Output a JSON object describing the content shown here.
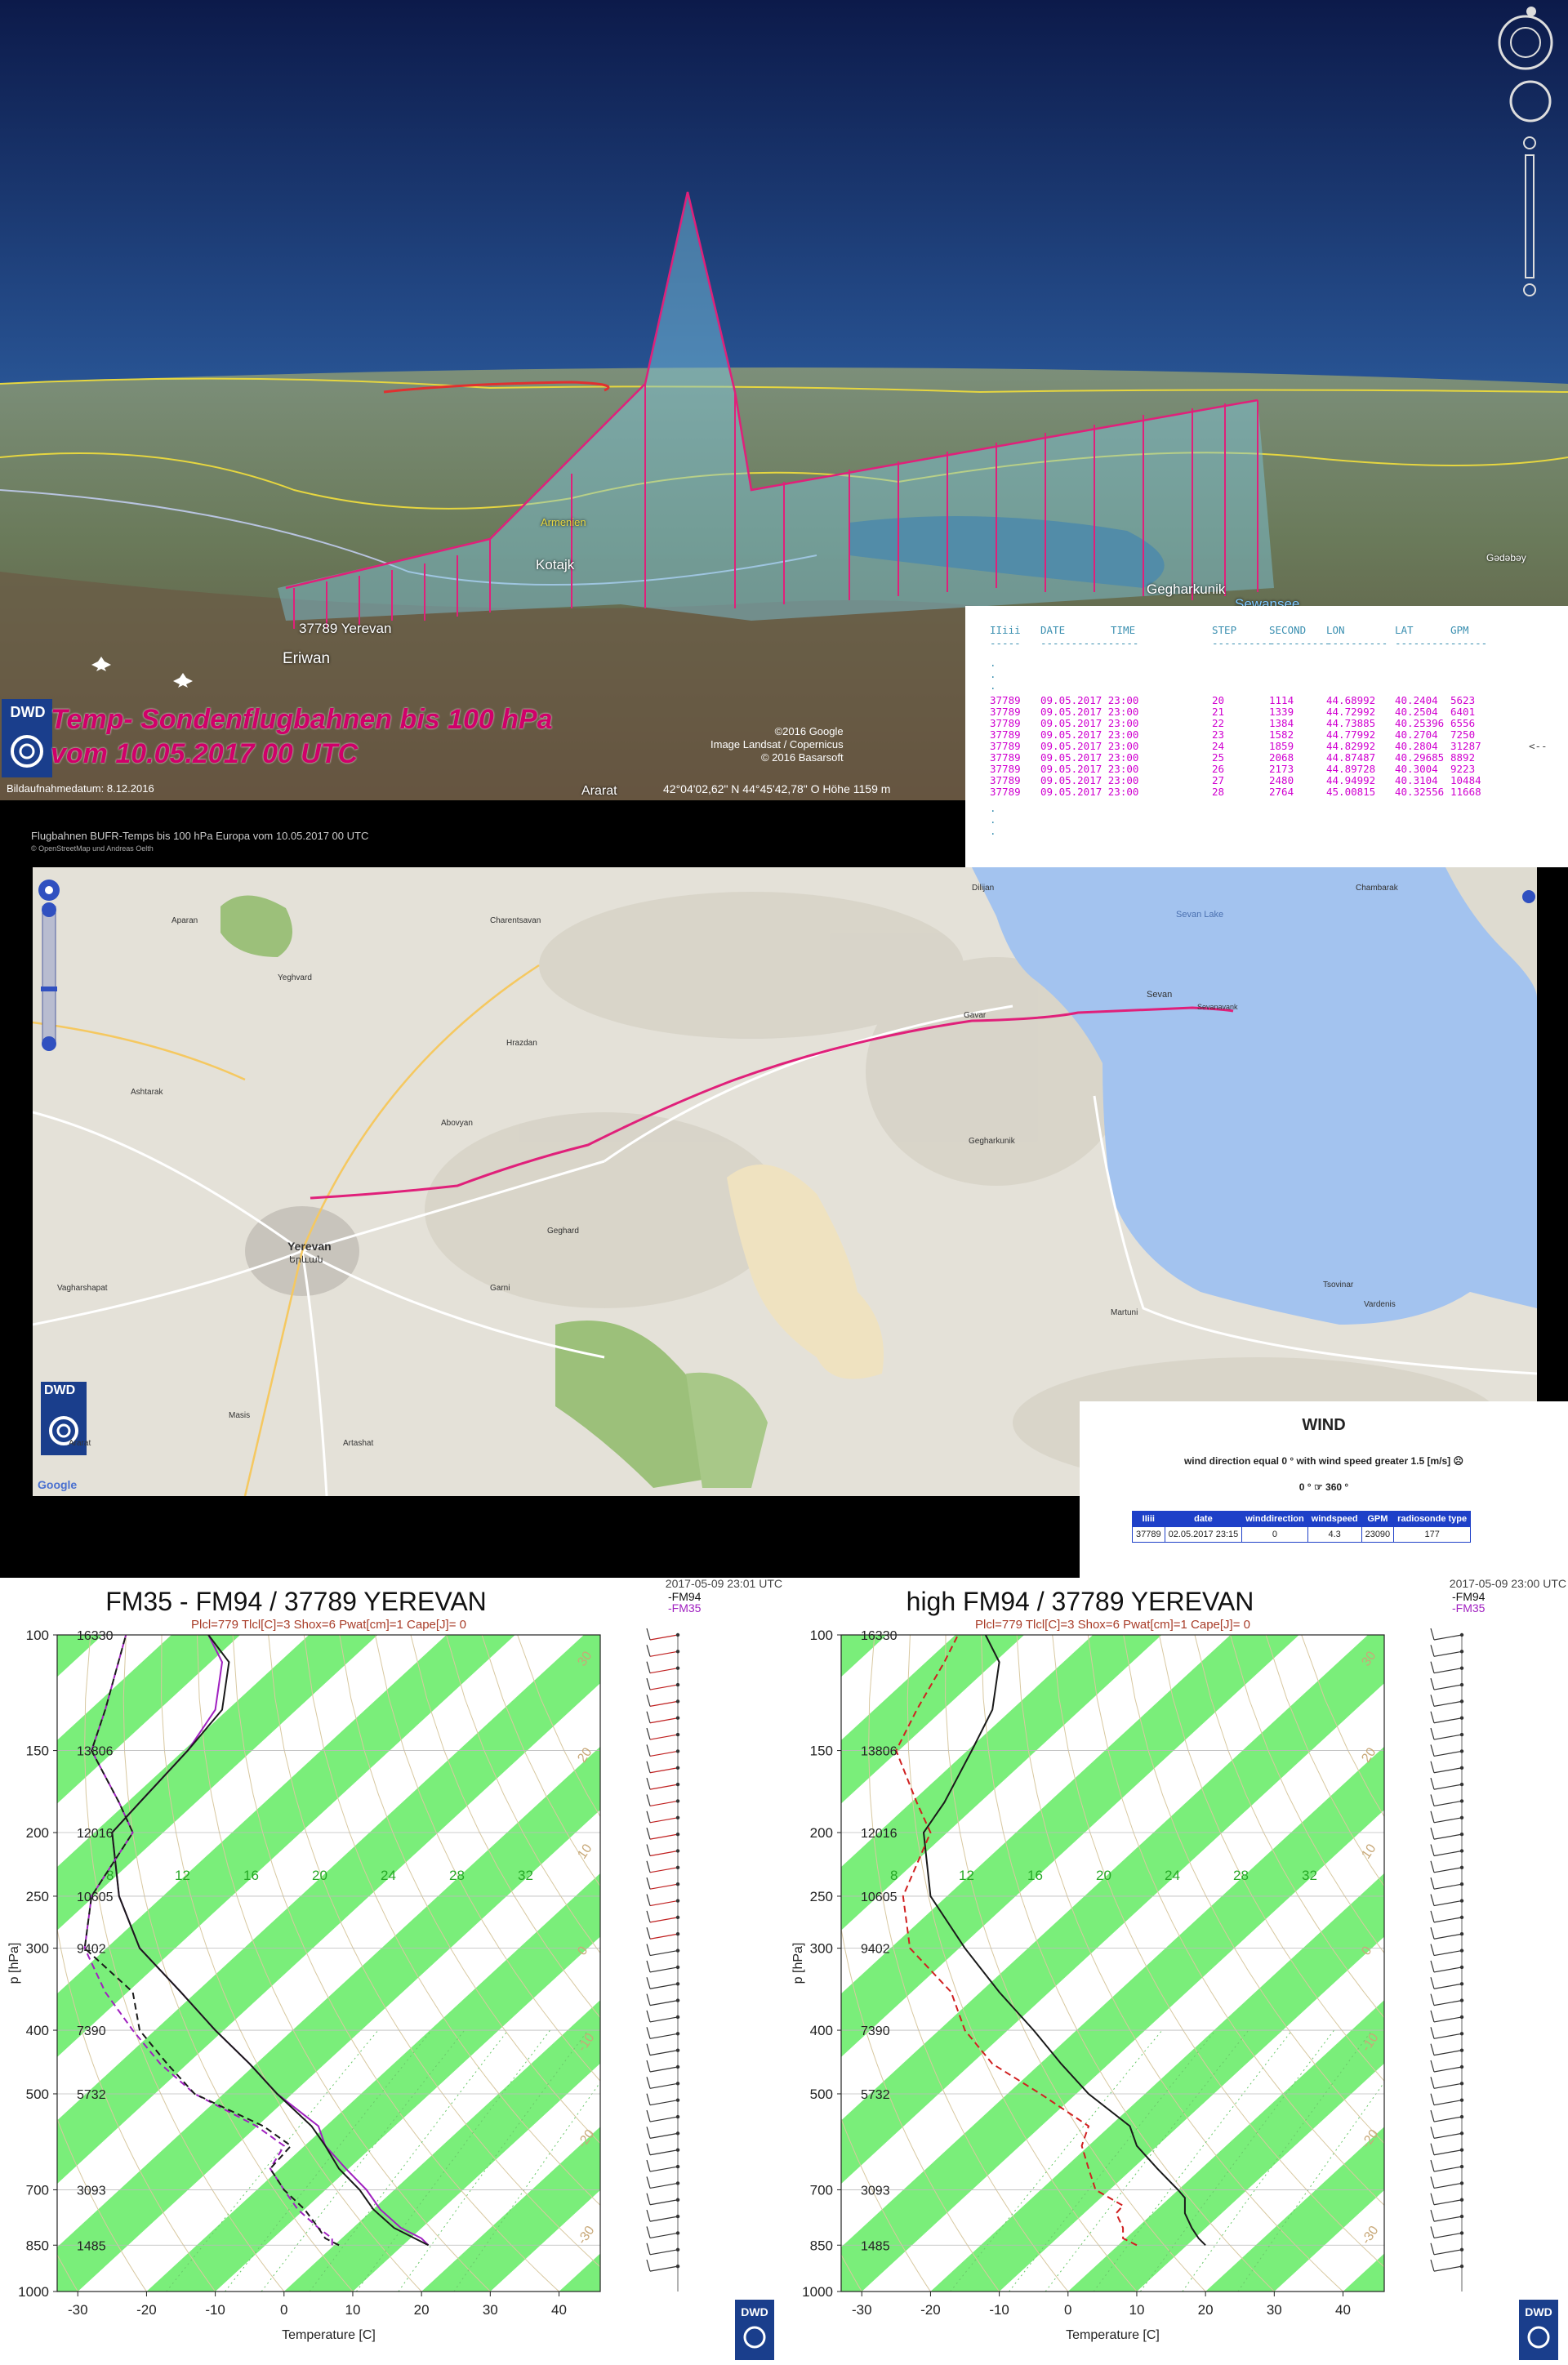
{
  "top_panel": {
    "title_line1": "Temp- Sondenflugbahnen bis 100 hPa",
    "title_line2": "vom 10.05.2017 00 UTC",
    "logo": "DWD",
    "image_date": "Bildaufnahmedatum: 8.12.2016",
    "coords": "42°04'02,62\" N   44°45'42,78\" O Höhe 1159 m",
    "credit1": "©2016 Google",
    "credit2": "Image Landsat / Copernicus",
    "credit3": "© 2016 Basarsoft",
    "places": {
      "station": "37789 Yerevan",
      "eriwan": "Eriwan",
      "kotajk": "Kotajk",
      "armenien": "Armenien",
      "gegharkunik": "Gegharkunik",
      "sevan": "Sewansee",
      "gadabay": "Gədəbəy",
      "ararat": "Ararat"
    }
  },
  "data_table": {
    "header": [
      "IIiii",
      "DATE",
      "TIME",
      "STEP",
      "SECOND",
      "LON",
      "LAT",
      "GPM"
    ],
    "dashes": [
      "-----",
      "----------------",
      "",
      "----------",
      "----------",
      "----------",
      "----------",
      "------"
    ],
    "rows": [
      [
        "37789",
        "09.05.2017 23:00",
        "20",
        "1114",
        "44.68992",
        "40.2404",
        "5623"
      ],
      [
        "37789",
        "09.05.2017 23:00",
        "21",
        "1339",
        "44.72992",
        "40.2504",
        "6401"
      ],
      [
        "37789",
        "09.05.2017 23:00",
        "22",
        "1384",
        "44.73885",
        "40.25396",
        "6556"
      ],
      [
        "37789",
        "09.05.2017 23:00",
        "23",
        "1582",
        "44.77992",
        "40.2704",
        "7250"
      ],
      [
        "37789",
        "09.05.2017 23:00",
        "24",
        "1859",
        "44.82992",
        "40.2804",
        "31287"
      ],
      [
        "37789",
        "09.05.2017 23:00",
        "25",
        "2068",
        "44.87487",
        "40.29685",
        "8892"
      ],
      [
        "37789",
        "09.05.2017 23:00",
        "26",
        "2173",
        "44.89728",
        "40.3004",
        "9223"
      ],
      [
        "37789",
        "09.05.2017 23:00",
        "27",
        "2480",
        "44.94992",
        "40.3104",
        "10484"
      ],
      [
        "37789",
        "09.05.2017 23:00",
        "28",
        "2764",
        "45.00815",
        "40.32556",
        "11668"
      ]
    ],
    "marker": "<--"
  },
  "map": {
    "caption": "Flugbahnen BUFR-Temps bis 100 hPa     Europa vom 10.05.2017 00 UTC",
    "caption_small": "© OpenStreetMap und Andreas Oelth",
    "google": "Google",
    "logo": "DWD",
    "labels": {
      "yerevan": "Yerevan",
      "yerevan_arm": "Երևան",
      "sevan_lake": "Sevan Lake",
      "sevan": "Sevan",
      "gavar": "Gavar",
      "hrazdan": "Hrazdan",
      "abovyan": "Abovyan",
      "ashtarak": "Ashtarak",
      "vagharshapat": "Vagharshapat",
      "masis": "Masis",
      "artashat": "Artashat",
      "martuni": "Martuni",
      "vardenis": "Vardenis",
      "garni": "Garni",
      "yeghvard": "Yeghvard",
      "charentsavan": "Charentsavan",
      "chambarak": "Chambarak",
      "tsovinar": "Tsovinar",
      "gegharkunik": "Gegharkunik",
      "dilijan": "Dilijan",
      "ararat": "Ararat",
      "aparan": "Aparan",
      "geghard": "Geghard",
      "sevanavank": "Sevanavank"
    }
  },
  "wind": {
    "title": "WIND",
    "desc": "wind direction equal 0 ° with wind speed greater 1.5 [m/s] ☹",
    "range": "0 ° ☞ 360 °",
    "columns": [
      "IIiii",
      "date",
      "winddirection",
      "windspeed",
      "GPM",
      "radiosonde type"
    ],
    "row": [
      "37789",
      "02.05.2017 23:15",
      "0",
      "4.3",
      "23090",
      "177"
    ]
  },
  "colors": {
    "trajectory": "#e0207a",
    "dry_bands": "#7aee7a",
    "fm94_series": "#1a1a1a",
    "fm35_series": "#a020c0",
    "high_dew": "#d02020"
  },
  "chart_data": [
    {
      "type": "line",
      "title": "FM35 - FM94 / 37789 YEREVAN",
      "subtitle": "Plcl=779 Tlcl[C]=3 Shox=6 Pwat[cm]=1 Cape[J]= 0",
      "timestamp": "2017-05-09 23:01 UTC",
      "legend": [
        "-FM94",
        "-FM35"
      ],
      "xlabel": "Temperature [C]",
      "ylabel": "p [hPa]",
      "xlim": [
        -33,
        46
      ],
      "ylim": [
        1000,
        100
      ],
      "log_pressure_axis": true,
      "x_ticks": [
        -30,
        -20,
        -10,
        0,
        10,
        20,
        30,
        40
      ],
      "y_ticks": [
        100,
        150,
        200,
        250,
        300,
        400,
        500,
        700,
        850,
        1000
      ],
      "heights": [
        "16330",
        "13806",
        "12016",
        "10605",
        "9402",
        "7390",
        "5732",
        "3093",
        "1485",
        ""
      ],
      "mixing_ratio_labels": [
        "8",
        "12",
        "16",
        "20",
        "24",
        "28",
        "32"
      ],
      "skew_labels": [
        "-30",
        "-20",
        "-10",
        "0",
        "10",
        "20",
        "30"
      ],
      "series": [
        {
          "name": "-FM35",
          "kind": "temperature",
          "p": [
            850,
            830,
            800,
            750,
            700,
            650,
            600,
            560,
            500,
            450,
            400,
            350,
            300,
            250,
            200,
            180,
            150,
            130,
            110,
            100
          ],
          "t": [
            21,
            20,
            17,
            14,
            12,
            9,
            6,
            5,
            -1,
            -5,
            -10,
            -15,
            -21,
            -24,
            -25,
            -21,
            -14,
            -10,
            -9,
            -11
          ]
        },
        {
          "name": "-FM94",
          "kind": "temperature",
          "p": [
            850,
            830,
            800,
            750,
            700,
            650,
            600,
            560,
            500,
            450,
            400,
            350,
            300,
            250,
            200,
            180,
            150,
            130,
            110,
            100
          ],
          "t": [
            21,
            19,
            16,
            13,
            11,
            8,
            6,
            4,
            -1,
            -5,
            -10,
            -15,
            -21,
            -24,
            -25,
            -21,
            -14,
            -9,
            -8,
            -11
          ]
        },
        {
          "name": "-FM35",
          "kind": "dewpoint",
          "p": [
            850,
            830,
            800,
            750,
            700,
            650,
            600,
            560,
            500,
            450,
            400,
            350,
            300,
            250,
            200,
            180,
            150,
            130,
            100
          ],
          "t": [
            7,
            7,
            5,
            2,
            0,
            -2,
            0,
            -4,
            -13,
            -18,
            -22,
            -26,
            -29,
            -28,
            -22,
            -24,
            -28,
            -26,
            -23
          ]
        },
        {
          "name": "-FM94",
          "kind": "dewpoint",
          "p": [
            850,
            830,
            800,
            750,
            700,
            650,
            600,
            560,
            500,
            450,
            400,
            350,
            300,
            250,
            200,
            180,
            150,
            130,
            100
          ],
          "t": [
            8,
            6,
            5,
            3,
            0,
            -2,
            1,
            -3,
            -13,
            -17,
            -21,
            -22,
            -29,
            -28,
            -22,
            -24,
            -28,
            -26,
            -23
          ]
        }
      ]
    },
    {
      "type": "line",
      "title": "high FM94 / 37789 YEREVAN",
      "subtitle": "Plcl=779 Tlcl[C]=3 Shox=6 Pwat[cm]=1 Cape[J]= 0",
      "timestamp": "2017-05-09 23:00 UTC",
      "legend": [
        "-FM94",
        "-FM35"
      ],
      "xlabel": "Temperature [C]",
      "ylabel": "p [hPa]",
      "xlim": [
        -33,
        46
      ],
      "ylim": [
        1000,
        100
      ],
      "log_pressure_axis": true,
      "x_ticks": [
        -30,
        -20,
        -10,
        0,
        10,
        20,
        30,
        40
      ],
      "y_ticks": [
        100,
        150,
        200,
        250,
        300,
        400,
        500,
        700,
        850,
        1000
      ],
      "heights": [
        "16330",
        "13806",
        "12016",
        "10605",
        "9402",
        "7390",
        "5732",
        "3093",
        "1485",
        ""
      ],
      "mixing_ratio_labels": [
        "8",
        "12",
        "16",
        "20",
        "24",
        "28",
        "32"
      ],
      "skew_labels": [
        "-30",
        "-20",
        "-10",
        "0",
        "10",
        "20",
        "30"
      ],
      "series": [
        {
          "name": "-FM94",
          "kind": "temperature",
          "p": [
            850,
            830,
            800,
            760,
            720,
            700,
            650,
            600,
            560,
            500,
            450,
            400,
            350,
            300,
            250,
            200,
            180,
            150,
            130,
            110,
            100
          ],
          "t": [
            20,
            19,
            18,
            17,
            17,
            16,
            13,
            10,
            9,
            3,
            -1,
            -5,
            -10,
            -15,
            -20,
            -21,
            -18,
            -14,
            -11,
            -10,
            -12
          ]
        },
        {
          "name": "-FM94",
          "kind": "dewpoint",
          "p": [
            850,
            830,
            800,
            760,
            740,
            700,
            650,
            600,
            560,
            500,
            450,
            400,
            350,
            300,
            250,
            200,
            180,
            150,
            130,
            110,
            100
          ],
          "t": [
            10,
            8,
            8,
            7,
            8,
            4,
            3,
            2,
            3,
            -4,
            -11,
            -15,
            -17,
            -23,
            -24,
            -20,
            -22,
            -25,
            -22,
            -18,
            -16
          ]
        }
      ]
    }
  ]
}
